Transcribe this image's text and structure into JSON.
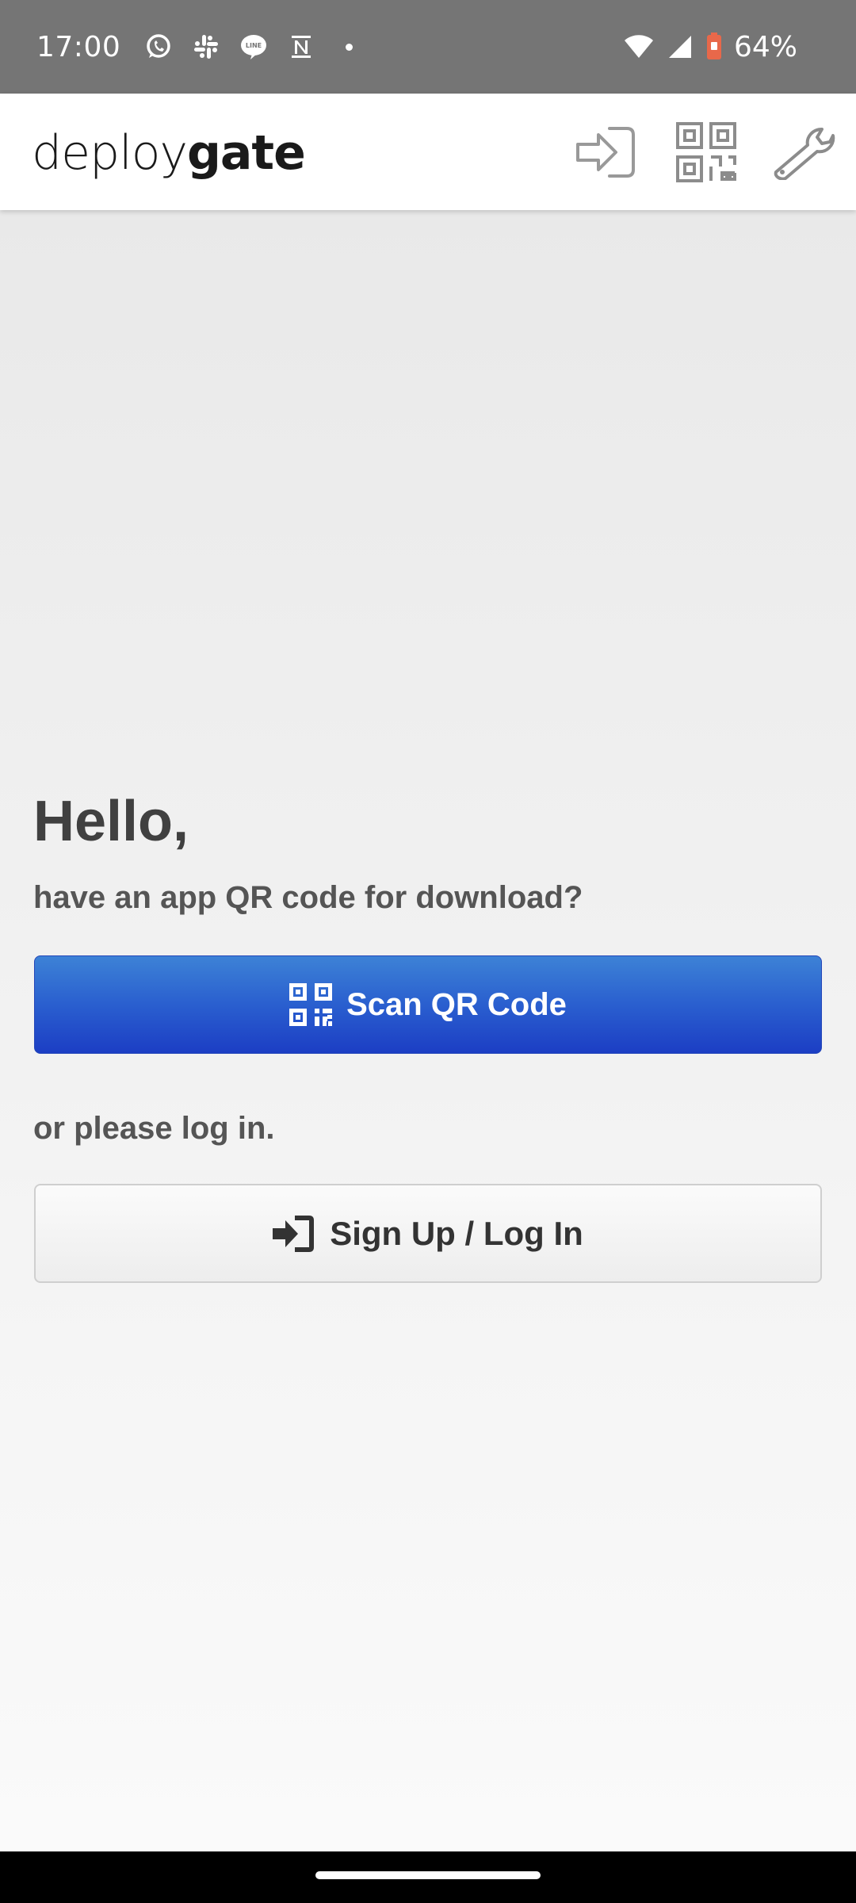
{
  "status_bar": {
    "time": "17:00",
    "notification_icons": [
      "whatsapp-icon",
      "slack-icon",
      "line-icon",
      "notion-icon",
      "more-dot-icon"
    ],
    "battery_percent": "64%",
    "battery_color": "#e8684a"
  },
  "header": {
    "logo_light": "deploy",
    "logo_bold": "gate",
    "icons": [
      "login-icon",
      "qr-code-icon",
      "wrench-icon"
    ]
  },
  "main": {
    "greeting": "Hello,",
    "qr_prompt": "have an app QR code for download?",
    "scan_button_label": "Scan QR Code",
    "login_prompt": "or please log in.",
    "login_button_label": "Sign Up / Log In"
  },
  "colors": {
    "primary_button": "#2a5fcf",
    "status_bar": "#757575"
  }
}
